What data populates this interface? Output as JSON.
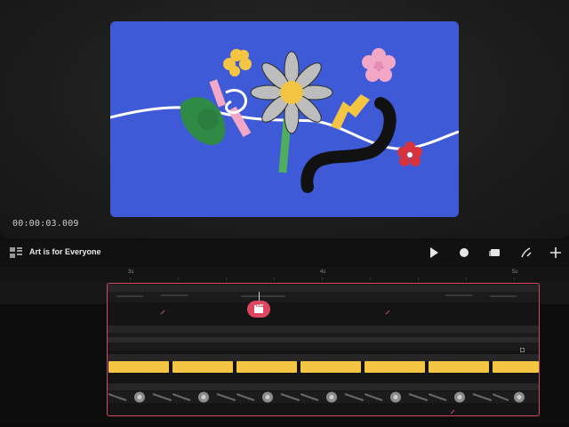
{
  "preview": {
    "timecode": "00:00:03.009"
  },
  "toolbar": {
    "project_title": "Art is for Everyone",
    "buttons": [
      {
        "name": "play-button",
        "icon": "play-icon"
      },
      {
        "name": "record-button",
        "icon": "record-icon"
      },
      {
        "name": "media-button",
        "icon": "media-icon"
      },
      {
        "name": "draw-button",
        "icon": "pen-icon"
      },
      {
        "name": "add-button",
        "icon": "plus-icon"
      }
    ]
  },
  "ruler": {
    "labels": [
      "3s",
      "4s",
      "5s"
    ]
  },
  "colors": {
    "canvas_bg": "#3f5ad6",
    "accent": "#e0465f",
    "track_highlight": "#d44a62",
    "clip_yellow": "#f4c542"
  }
}
